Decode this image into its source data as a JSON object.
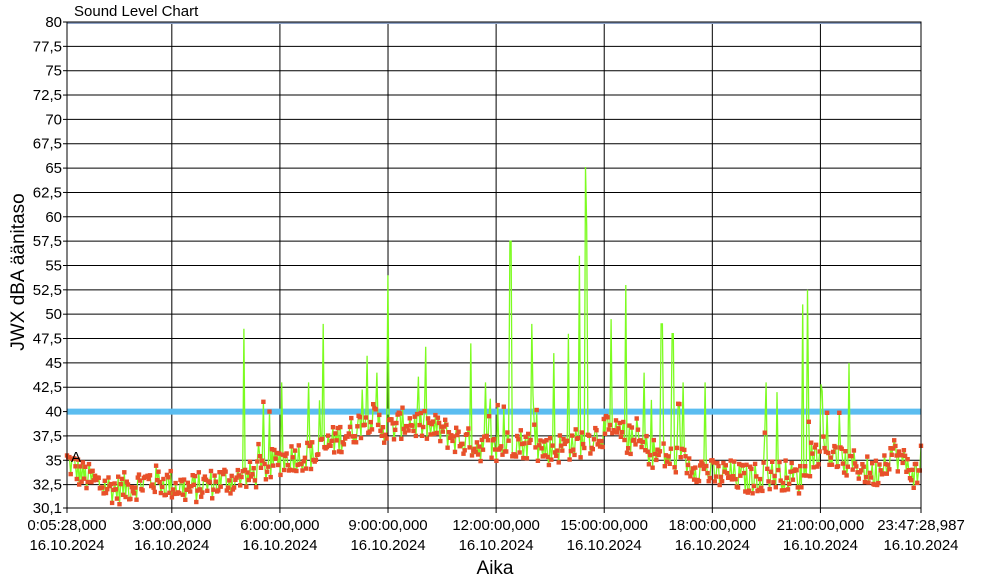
{
  "chart_data": {
    "type": "line",
    "title": "Sound Level Chart",
    "xlabel": "Aika",
    "ylabel": "JWX dBA äänitaso",
    "ylim": [
      30.1,
      80
    ],
    "y_ticks": [
      "30,1",
      "32,5",
      "35",
      "37,5",
      "40",
      "42,5",
      "45",
      "47,5",
      "50",
      "52,5",
      "55",
      "57,5",
      "60",
      "62,5",
      "65",
      "67,5",
      "70",
      "72,5",
      "75",
      "77,5",
      "80"
    ],
    "x_ticks": [
      {
        "time": "0:05:28,000",
        "date": "16.10.2024"
      },
      {
        "time": "3:00:00,000",
        "date": "16.10.2024"
      },
      {
        "time": "6:00:00,000",
        "date": "16.10.2024"
      },
      {
        "time": "9:00:00,000",
        "date": "16.10.2024"
      },
      {
        "time": "12:00:00,000",
        "date": "16.10.2024"
      },
      {
        "time": "15:00:00,000",
        "date": "16.10.2024"
      },
      {
        "time": "18:00:00,000",
        "date": "16.10.2024"
      },
      {
        "time": "21:00:00,000",
        "date": "16.10.2024"
      },
      {
        "time": "23:47:28,987",
        "date": "16.10.2024"
      }
    ],
    "threshold": {
      "value": 40,
      "color": "#5BBDF0"
    },
    "annotation": "A",
    "series": [
      {
        "color": "#7CFC20",
        "marker_color": "#E8502A",
        "x_hours": [
          0.09,
          0.5,
          1.0,
          1.5,
          2.0,
          2.5,
          3.0,
          3.5,
          4.0,
          4.5,
          5.0,
          5.5,
          6.0,
          6.5,
          7.0,
          7.5,
          8.0,
          8.5,
          9.0,
          9.5,
          10.0,
          10.5,
          11.0,
          11.5,
          12.0,
          12.5,
          13.0,
          13.5,
          14.0,
          14.5,
          15.0,
          15.5,
          16.0,
          16.5,
          17.0,
          17.5,
          18.0,
          18.5,
          19.0,
          19.5,
          20.0,
          20.5,
          21.0,
          21.5,
          22.0,
          22.5,
          23.0,
          23.5,
          23.79
        ],
        "values": [
          35,
          33.5,
          32.5,
          32,
          32.5,
          33,
          32.5,
          32,
          32.5,
          33,
          33,
          34,
          35,
          35.5,
          35.5,
          37,
          38,
          39.5,
          38,
          39,
          38.5,
          38,
          37,
          36.5,
          36,
          37,
          36.5,
          36,
          36.5,
          37,
          38,
          37.5,
          36.5,
          35.5,
          35,
          34.5,
          33.5,
          33.5,
          33,
          33.5,
          33.5,
          33,
          36.5,
          35,
          34.5,
          33.5,
          36,
          34,
          33
        ]
      }
    ]
  }
}
